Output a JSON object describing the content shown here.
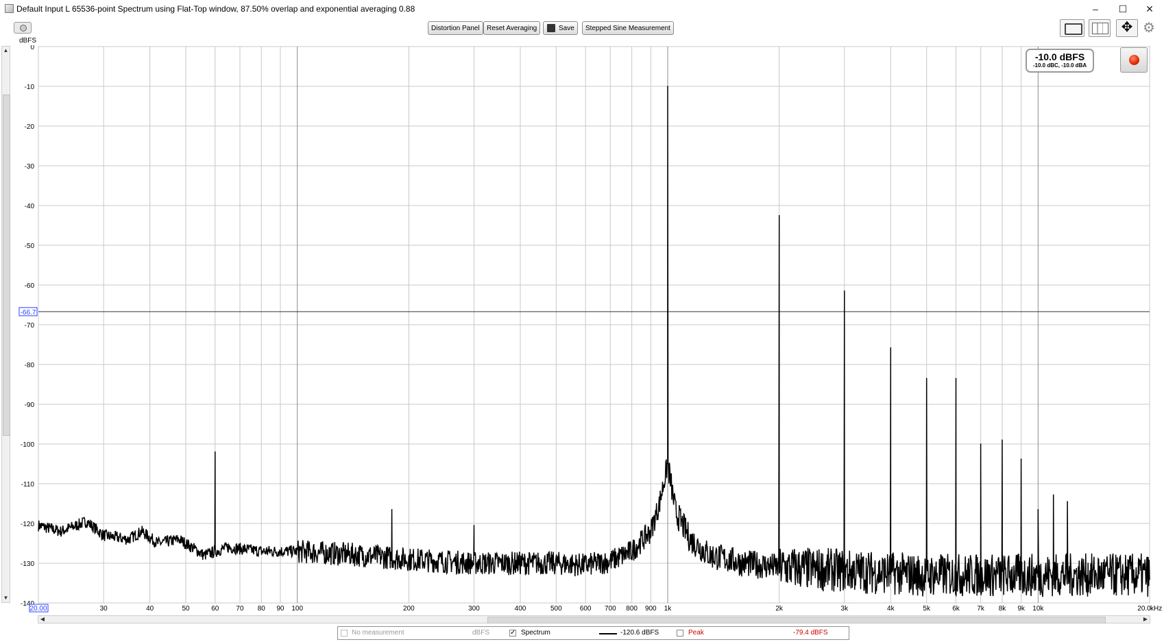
{
  "window": {
    "title": "Default Input L 65536-point Spectrum using Flat-Top window, 87.50% overlap and exponential averaging 0.88"
  },
  "toolbar": {
    "buttons": [
      "Distortion Panel",
      "Reset Averaging",
      "Save",
      "Stepped Sine Measurement"
    ]
  },
  "readout": {
    "level": "-10.0 dBFS",
    "weighted": "-10.0 dBC, -10.0 dBA"
  },
  "legend": {
    "no_measurement": "No measurement",
    "no_measurement_unit": "dBFS",
    "spectrum_label": "Spectrum",
    "spectrum_value": "-120.6 dBFS",
    "peak_label": "Peak",
    "peak_value": "-79.4 dBFS"
  },
  "chart_data": {
    "type": "line",
    "ylabel": "dBFS",
    "xunit": "kHz",
    "xscale": "log",
    "xlim": [
      20,
      20000
    ],
    "ylim": [
      -140,
      0
    ],
    "x_tick_values": [
      20,
      30,
      40,
      50,
      60,
      70,
      80,
      90,
      100,
      200,
      300,
      400,
      500,
      600,
      700,
      800,
      900,
      1000,
      2000,
      3000,
      4000,
      5000,
      6000,
      7000,
      8000,
      9000,
      10000,
      20000
    ],
    "x_tick_labels": [
      "20.00",
      "30",
      "40",
      "50",
      "60",
      "70",
      "80",
      "90",
      "100",
      "200",
      "300",
      "400",
      "500",
      "600",
      "700",
      "800",
      "900",
      "1k",
      "2k",
      "3k",
      "4k",
      "5k",
      "6k",
      "7k",
      "8k",
      "9k",
      "10k",
      "20.0"
    ],
    "y_ticks": [
      0,
      -10,
      -20,
      -30,
      -40,
      -50,
      -60,
      -70,
      -80,
      -90,
      -100,
      -110,
      -120,
      -130,
      -140
    ],
    "cursor_level": -66.7,
    "cursor_label": "-66.7",
    "grid": true,
    "series": [
      {
        "name": "Spectrum",
        "color": "#000000",
        "noise_floor": [
          [
            20,
            -120.5
          ],
          [
            23,
            -122
          ],
          [
            27,
            -119.5
          ],
          [
            30,
            -123
          ],
          [
            35,
            -124
          ],
          [
            38,
            -122
          ],
          [
            42,
            -125
          ],
          [
            48,
            -124
          ],
          [
            52,
            -126
          ],
          [
            56,
            -128
          ],
          [
            65,
            -126
          ],
          [
            80,
            -127
          ],
          [
            100,
            -127
          ],
          [
            150,
            -128
          ],
          [
            200,
            -129
          ],
          [
            300,
            -130
          ],
          [
            400,
            -130
          ],
          [
            500,
            -130
          ],
          [
            600,
            -130.5
          ],
          [
            700,
            -129.5
          ],
          [
            800,
            -127
          ],
          [
            900,
            -122
          ],
          [
            950,
            -115
          ],
          [
            1000,
            -105
          ],
          [
            1050,
            -117
          ],
          [
            1150,
            -124
          ],
          [
            1300,
            -128
          ],
          [
            1600,
            -130
          ],
          [
            2000,
            -131
          ],
          [
            5000,
            -133
          ],
          [
            10000,
            -133
          ],
          [
            20000,
            -133
          ]
        ],
        "peaks": [
          {
            "freq": 60,
            "level": -102
          },
          {
            "freq": 180,
            "level": -116.5
          },
          {
            "freq": 300,
            "level": -120.5
          },
          {
            "freq": 1000,
            "level": -10
          },
          {
            "freq": 2000,
            "level": -42.5
          },
          {
            "freq": 3000,
            "level": -61.5
          },
          {
            "freq": 4000,
            "level": -75.8
          },
          {
            "freq": 5000,
            "level": -83.5
          },
          {
            "freq": 6000,
            "level": -83.5
          },
          {
            "freq": 7000,
            "level": -100
          },
          {
            "freq": 8000,
            "level": -99
          },
          {
            "freq": 9000,
            "level": -103.8
          },
          {
            "freq": 10000,
            "level": -116.5
          },
          {
            "freq": 11000,
            "level": -112.8
          },
          {
            "freq": 12000,
            "level": -114.5
          }
        ]
      }
    ]
  }
}
